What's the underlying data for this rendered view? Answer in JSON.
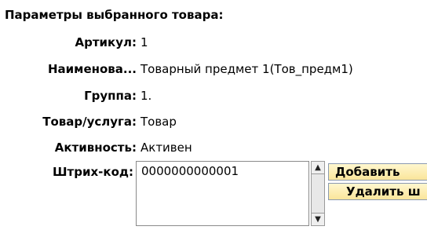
{
  "panel": {
    "title": "Параметры выбранного товара:"
  },
  "fields": {
    "article": {
      "label": "Артикул:",
      "value": "1"
    },
    "name": {
      "label": "Наименова...",
      "value": "Товарный предмет 1(Тов_предм1)"
    },
    "group": {
      "label": "Группа:",
      "value": "1."
    },
    "type": {
      "label": "Товар/услуга:",
      "value": "Товар"
    },
    "activity": {
      "label": "Активность:",
      "value": "Активен"
    },
    "barcode": {
      "label": "Штрих-код:",
      "items": [
        "0000000000001"
      ]
    }
  },
  "buttons": {
    "add": "Добавить",
    "delete": "Удалить ш"
  },
  "scroll": {
    "up_icon": "arrow-up-icon",
    "down_icon": "arrow-down-icon"
  }
}
